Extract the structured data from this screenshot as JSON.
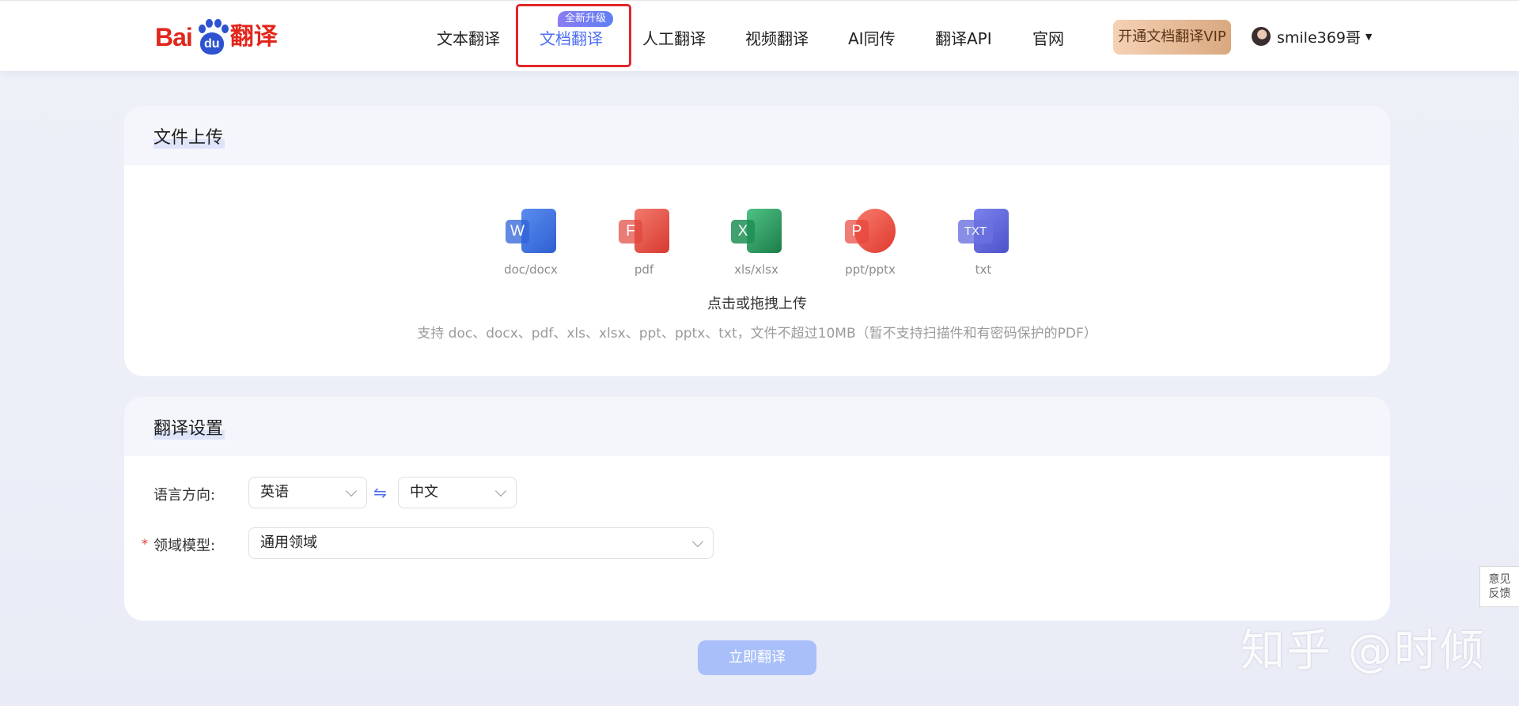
{
  "header": {
    "logo": {
      "text_left": "Bai",
      "paw_text": "du",
      "text_right": "翻译"
    },
    "nav": [
      {
        "label": "文本翻译"
      },
      {
        "label": "文档翻译",
        "badge": "全新升级",
        "active": true
      },
      {
        "label": "人工翻译"
      },
      {
        "label": "视频翻译"
      },
      {
        "label": "AI同传"
      },
      {
        "label": "翻译API"
      },
      {
        "label": "官网"
      }
    ],
    "vip_button": "开通文档翻译VIP",
    "username": "smile369哥"
  },
  "upload": {
    "title": "文件上传",
    "file_types": [
      {
        "label": "doc/docx",
        "icon": "word-icon",
        "glyph": "W",
        "color": "#2f63d8"
      },
      {
        "label": "pdf",
        "icon": "pdf-icon",
        "glyph": "F",
        "color": "#e0463c"
      },
      {
        "label": "xls/xlsx",
        "icon": "excel-icon",
        "glyph": "X",
        "color": "#1f8f55"
      },
      {
        "label": "ppt/pptx",
        "icon": "powerpoint-icon",
        "glyph": "P",
        "color": "#e8453a"
      },
      {
        "label": "txt",
        "icon": "txt-icon",
        "glyph": "TXT",
        "color": "#5b63d6"
      }
    ],
    "action_text": "点击或拖拽上传",
    "hint": "支持 doc、docx、pdf、xls、xlsx、ppt、pptx、txt，文件不超过10MB（暂不支持扫描件和有密码保护的PDF）"
  },
  "settings": {
    "title": "翻译设置",
    "language_label": "语言方向:",
    "source_language": "英语",
    "swap_symbol": "⇋",
    "target_language": "中文",
    "domain_label": "领域模型:",
    "domain_required": "*",
    "domain_value": "通用领域"
  },
  "translate_button": "立即翻译",
  "feedback": {
    "line1": "意见",
    "line2": "反馈"
  },
  "watermark": "知乎 @时倾"
}
